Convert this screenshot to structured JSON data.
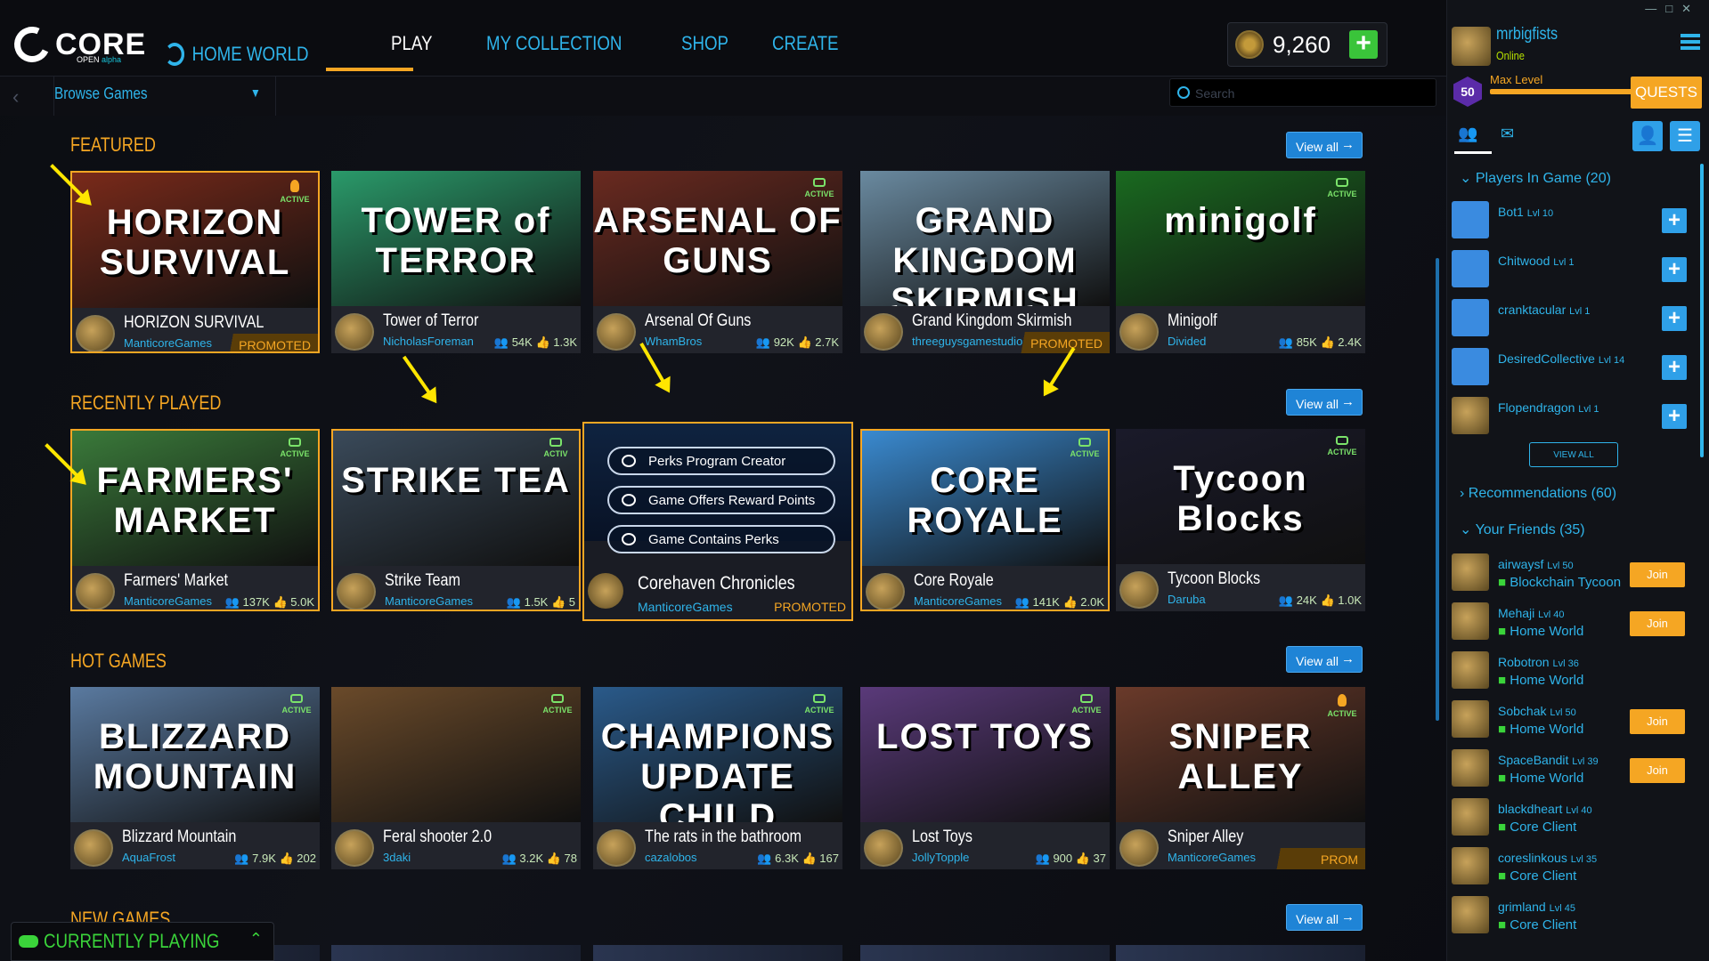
{
  "nav": {
    "home": "HOME WORLD",
    "play": "PLAY",
    "collection": "MY COLLECTION",
    "shop": "SHOP",
    "create": "CREATE"
  },
  "logo": {
    "text": "CORE",
    "sub_a": "OPEN ",
    "sub_b": "alpha"
  },
  "currency": {
    "value": "9,260"
  },
  "browse": {
    "label": "Browse Games"
  },
  "search": {
    "placeholder": "Search"
  },
  "sections": {
    "featured": {
      "title": "FEATURED",
      "view_all": "View all",
      "cards": [
        {
          "name": "HORIZON SURVIVAL",
          "creator": "ManticoreGames",
          "promo": "PROMOTED",
          "badge": "ACTIVE",
          "art_text": "HORIZON SURVIVAL",
          "art_color": "#7a2a1a"
        },
        {
          "name": "Tower of Terror",
          "creator": "NicholasForeman",
          "stats": "👥 54K 👍 1.3K",
          "art_text": "TOWER of TERROR",
          "art_color": "#2a9a6a"
        },
        {
          "name": "Arsenal Of Guns",
          "creator": "WhamBros",
          "stats": "👥 92K 👍 2.7K",
          "badge": "ACTIVE",
          "art_text": "ARSENAL OF GUNS",
          "art_color": "#6a2a20"
        },
        {
          "name": "Grand Kingdom Skirmish",
          "creator": "threeguysgamestudio",
          "promo": "PROMOTED",
          "art_text": "GRAND KINGDOM SKIRMISH",
          "art_color": "#6a8aa0"
        },
        {
          "name": "Minigolf",
          "creator": "Divided",
          "stats": "👥 85K 👍 2.4K",
          "badge": "ACTIVE",
          "art_text": "minigolf",
          "art_color": "#1a6a20"
        }
      ]
    },
    "recent": {
      "title": "RECENTLY PLAYED",
      "view_all": "View all",
      "cards": [
        {
          "name": "Farmers' Market",
          "creator": "ManticoreGames",
          "stats": "👥 137K 👍 5.0K",
          "badge": "ACTIVE",
          "art_text": "FARMERS' MARKET",
          "art_color": "#3a7a3a"
        },
        {
          "name": "Strike Team",
          "creator": "ManticoreGames",
          "stats": "👥 1.5K 👍 5",
          "badge": "ACTIV",
          "art_text": "STRIKE TEA",
          "art_color": "#3a4a5a"
        },
        {
          "name": "Corehaven Chronicles",
          "creator": "ManticoreGames",
          "promo": "PROMOTED"
        },
        {
          "name": "Core Royale",
          "creator": "ManticoreGames",
          "stats": "👥 141K 👍 2.0K",
          "badge": "ACTIVE",
          "art_text": "CORE ROYALE",
          "art_color": "#3a8ad0"
        },
        {
          "name": "Tycoon Blocks",
          "creator": "Daruba",
          "stats": "👥 24K 👍 1.0K",
          "badge": "ACTIVE",
          "art_text": "Tycoon Blocks",
          "art_color": "#1a1a2a"
        }
      ],
      "perks": [
        "Perks Program Creator",
        "Game Offers Reward Points",
        "Game Contains Perks"
      ]
    },
    "hot": {
      "title": "HOT GAMES",
      "view_all": "View all",
      "cards": [
        {
          "name": "Blizzard Mountain",
          "creator": "AquaFrost",
          "stats": "👥 7.9K 👍 202",
          "badge": "ACTIVE",
          "art_text": "BLIZZARD MOUNTAIN",
          "art_color": "#5a7aa0"
        },
        {
          "name": "Feral shooter 2.0",
          "creator": "3daki",
          "stats": "👥 3.2K 👍 78",
          "badge": "ACTIVE",
          "art_text": "",
          "art_color": "#6a4a2a"
        },
        {
          "name": "The rats in the bathroom",
          "creator": "cazalobos",
          "stats": "👥 6.3K 👍 167",
          "badge": "ACTIVE",
          "art_text": "CHAMPIONS UPDATE CHILD PROTECTORS",
          "art_color": "#2a5a8a"
        },
        {
          "name": "Lost Toys",
          "creator": "JollyTopple",
          "stats": "👥 900 👍 37",
          "badge": "ACTIVE",
          "art_text": "LOST TOYS",
          "art_color": "#5a3a7a"
        },
        {
          "name": "Sniper Alley",
          "creator": "ManticoreGames",
          "promo": "PROM",
          "badge": "ACTIVE",
          "art_text": "SNIPER ALLEY",
          "art_color": "#6a3a2a"
        }
      ]
    },
    "new": {
      "title": "NEW GAMES",
      "view_all": "View all"
    }
  },
  "sidebar": {
    "username": "mrbigfists",
    "status": "Online",
    "level": "50",
    "level_label": "Max Level",
    "quests": "QUESTS",
    "players_header": "Players In Game (20)",
    "view_all": "VIEW ALL",
    "players": [
      {
        "name": "Bot1",
        "lvl": "Lvl 10"
      },
      {
        "name": "Chitwood",
        "lvl": "Lvl 1"
      },
      {
        "name": "cranktacular",
        "lvl": "Lvl 1"
      },
      {
        "name": "DesiredCollective",
        "lvl": "Lvl 14"
      },
      {
        "name": "Flopendragon",
        "lvl": "Lvl 1"
      }
    ],
    "recommendations_header": "Recommendations (60)",
    "friends_header": "Your Friends (35)",
    "friends": [
      {
        "name": "airwaysf",
        "lvl": "Lvl 50",
        "status": "Blockchain Tycoon",
        "join": "Join"
      },
      {
        "name": "Mehaji",
        "lvl": "Lvl 40",
        "status": "Home World",
        "join": "Join"
      },
      {
        "name": "Robotron",
        "lvl": "Lvl 36",
        "status": "Home World"
      },
      {
        "name": "Sobchak",
        "lvl": "Lvl 50",
        "status": "Home World",
        "join": "Join"
      },
      {
        "name": "SpaceBandit",
        "lvl": "Lvl 39",
        "status": "Home World",
        "join": "Join"
      },
      {
        "name": "blackdheart",
        "lvl": "Lvl 40",
        "status": "Core Client"
      },
      {
        "name": "coreslinkous",
        "lvl": "Lvl 35",
        "status": "Core Client"
      },
      {
        "name": "grimland",
        "lvl": "Lvl 45",
        "status": "Core Client"
      }
    ]
  },
  "currently_playing": "CURRENTLY PLAYING"
}
